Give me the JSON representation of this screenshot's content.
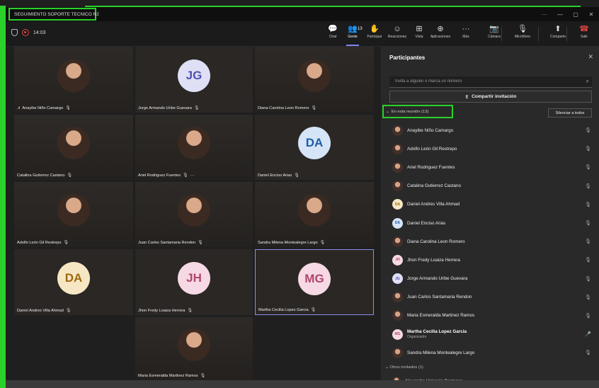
{
  "window": {
    "title": "SEGUIMIENTO SOPORTE TECNICO N2",
    "more": "···",
    "minimize": "—",
    "maximize": "▢",
    "close": "✕"
  },
  "toolbar": {
    "timer": "14:03",
    "people_count": "13",
    "buttons": [
      {
        "label": "Chat",
        "icon": "chat-icon",
        "glyph": "💬"
      },
      {
        "label": "Gente",
        "icon": "people-icon",
        "glyph": "👥"
      },
      {
        "label": "Participar",
        "icon": "raise-hand-icon",
        "glyph": "✋"
      },
      {
        "label": "Reacciones",
        "icon": "smiley-icon",
        "glyph": "☺"
      },
      {
        "label": "Vista",
        "icon": "grid-view-icon",
        "glyph": "⊞"
      },
      {
        "label": "Aplicaciones",
        "icon": "apps-icon",
        "glyph": "⊕"
      },
      {
        "label": "Más",
        "icon": "more-icon",
        "glyph": "···"
      },
      {
        "label": "Cámara",
        "icon": "camera-off-icon",
        "glyph": "📷"
      },
      {
        "label": "Micrófono",
        "icon": "mic-off-icon",
        "glyph": "🎙"
      },
      {
        "label": "Comparte",
        "icon": "share-icon",
        "glyph": "⬆"
      },
      {
        "label": "Salir",
        "icon": "hang-up-icon",
        "glyph": "☎"
      }
    ]
  },
  "tiles": [
    {
      "name": "Anayibe Niño Camargo",
      "type": "photo",
      "signal": ".ıl"
    },
    {
      "name": "Jorge Armando Uribe Guevara",
      "type": "initials",
      "initials": "JG",
      "bg": "#dfe0f5",
      "fg": "#4f52b2"
    },
    {
      "name": "Diana Carolina Leon Romero",
      "type": "photo"
    },
    {
      "name": "Catalina Gutierrez Castano",
      "type": "photo"
    },
    {
      "name": "Ariel Rodriguez Fuentes",
      "type": "photo",
      "extra": "···"
    },
    {
      "name": "Daniel Enciso Arias",
      "type": "initials",
      "initials": "DA",
      "bg": "#d6e4f7",
      "fg": "#1b5ea6"
    },
    {
      "name": "Adolfo León Gil Restrepo",
      "type": "photo"
    },
    {
      "name": "Juan Carlos Santamaria Rendon",
      "type": "photo"
    },
    {
      "name": "Sandra Milena Montealegre Largo",
      "type": "photo"
    },
    {
      "name": "Daniel Andres Villa Ahmad",
      "type": "initials",
      "initials": "DA",
      "bg": "#f7e6c4",
      "fg": "#9b6a0c"
    },
    {
      "name": "Jhon Fredy Loaiza Herrera",
      "type": "initials",
      "initials": "JH",
      "bg": "#f6d9e4",
      "fg": "#b1466c"
    },
    {
      "name": "Martha Cecilia Lopez Garcia",
      "type": "initials",
      "initials": "MG",
      "bg": "#f6d9e4",
      "fg": "#b1466c",
      "highlight": true
    },
    {
      "name": "Maria Esmeralda Martinez Ramos",
      "type": "photo"
    }
  ],
  "panel": {
    "title": "Participantes",
    "invite_placeholder": "Invita a alguien o marca un número",
    "share_invite": "Compartir invitación",
    "in_meeting": "En esta reunión (13)",
    "mute_all": "Silenciar a todos",
    "others": "Otros invitados (1)",
    "participants": [
      {
        "name": "Anayibe Niño Camargo",
        "av": "photo",
        "mic": "muted"
      },
      {
        "name": "Adolfo León Gil Restrepo",
        "av": "photo",
        "mic": "muted"
      },
      {
        "name": "Ariel Rodriguez Fuentes",
        "av": "photo",
        "mic": "muted"
      },
      {
        "name": "Catalina Gutierrez Castano",
        "av": "photo",
        "mic": "muted"
      },
      {
        "name": "Daniel Andres Villa Ahmad",
        "av": "initials",
        "initials": "DA",
        "bg": "#f7e6c4",
        "fg": "#9b6a0c",
        "mic": "muted"
      },
      {
        "name": "Daniel Enciso Arias",
        "av": "initials",
        "initials": "DA",
        "bg": "#d6e4f7",
        "fg": "#1b5ea6",
        "mic": "muted"
      },
      {
        "name": "Diana Carolina Leon Romero",
        "av": "photo",
        "mic": "muted"
      },
      {
        "name": "Jhon Fredy Loaiza Herrera",
        "av": "initials",
        "initials": "JH",
        "bg": "#f6d9e4",
        "fg": "#b1466c",
        "mic": "muted"
      },
      {
        "name": "Jorge Armando Uribe Guevara",
        "av": "initials",
        "initials": "JG",
        "bg": "#dfe0f5",
        "fg": "#4f52b2",
        "mic": "muted"
      },
      {
        "name": "Juan Carlos Santamaria Rendon",
        "av": "photo",
        "mic": "muted"
      },
      {
        "name": "Maria Esmeralda Martinez Ramos",
        "av": "photo",
        "mic": "muted"
      },
      {
        "name": "Martha Cecilia Lopez Garcia",
        "av": "initials",
        "initials": "MG",
        "bg": "#f6d9e4",
        "fg": "#b1466c",
        "mic": "on",
        "role": "Organizador",
        "bold": true
      },
      {
        "name": "Sandra Milena Montealegre Largo",
        "av": "photo",
        "mic": "muted"
      }
    ],
    "other_invitee": "Alexandra Valencia Carmona"
  }
}
